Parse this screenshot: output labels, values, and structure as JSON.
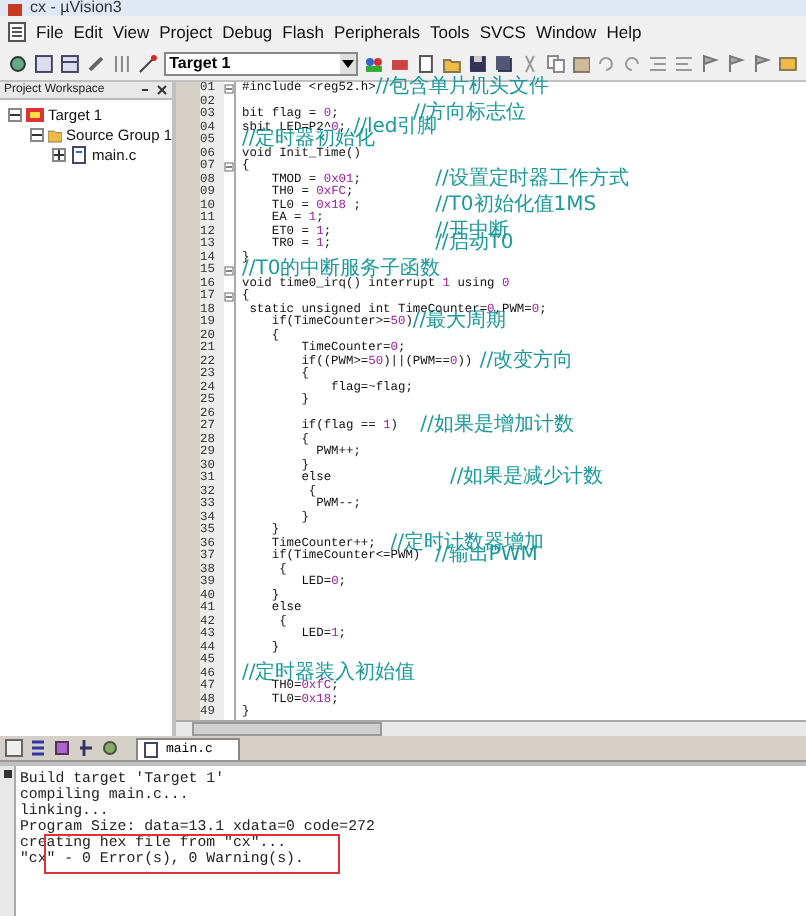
{
  "window": {
    "title": "cx - µVision3"
  },
  "menu": [
    "File",
    "Edit",
    "View",
    "Project",
    "Debug",
    "Flash",
    "Peripherals",
    "Tools",
    "SVCS",
    "Window",
    "Help"
  ],
  "toolbar": {
    "target": "Target 1"
  },
  "project_workspace": {
    "title": "Project Workspace",
    "tree": [
      {
        "label": "Target 1",
        "expanded": true,
        "children": [
          {
            "label": "Source Group 1",
            "expanded": true,
            "children": [
              {
                "label": "main.c",
                "expanded": false
              }
            ]
          }
        ]
      }
    ]
  },
  "editor": {
    "tab": "main.c",
    "lines": [
      {
        "n": "01",
        "code": "#include <reg52.h>",
        "comment": "//包含单片机头文件",
        "fold": true
      },
      {
        "n": "02",
        "fold": false
      },
      {
        "n": "03",
        "code": "bit flag = 0;          ",
        "comment": "//方向标志位",
        "fold": false
      },
      {
        "n": "04",
        "code": "sbit LED=P2^0; ",
        "comment": "//led引脚",
        "fold": false
      },
      {
        "n": "05",
        "comment": "//定时器初始化",
        "fold": false
      },
      {
        "n": "06",
        "code": "void Init_Time()",
        "fold": false
      },
      {
        "n": "07",
        "code": "{",
        "fold": true
      },
      {
        "n": "08",
        "code": "    TMOD = 0x01;          ",
        "comment": "//设置定时器工作方式",
        "fold": false
      },
      {
        "n": "09",
        "code": "    TH0 = 0xFC;",
        "fold": false
      },
      {
        "n": "10",
        "code": "    TL0 = 0x18 ;          ",
        "comment": "//T0初始化值1MS",
        "fold": false
      },
      {
        "n": "11",
        "code": "    EA = 1;",
        "fold": false
      },
      {
        "n": "12",
        "code": "    ET0 = 1;              ",
        "comment": "//开中断",
        "fold": false
      },
      {
        "n": "13",
        "code": "    TR0 = 1;              ",
        "comment": "//启动T0",
        "fold": false
      },
      {
        "n": "14",
        "code": "}",
        "fold": false
      },
      {
        "n": "15",
        "comment": "//T0的中断服务子函数",
        "fold": true
      },
      {
        "n": "16",
        "code": "void time0_irq() interrupt 1 using 0",
        "fold": false
      },
      {
        "n": "17",
        "code": "{",
        "fold": true
      },
      {
        "n": "18",
        "code": " static unsigned int TimeCounter=0,PWM=0;",
        "fold": false
      },
      {
        "n": "19",
        "code": "    if(TimeCounter>=50)",
        "comment": "//最大周期",
        "fold": false
      },
      {
        "n": "20",
        "code": "    {",
        "fold": false
      },
      {
        "n": "21",
        "code": "        TimeCounter=0;",
        "fold": false
      },
      {
        "n": "22",
        "code": "        if((PWM>=50)||(PWM==0)) ",
        "comment": "//改变方向",
        "fold": false
      },
      {
        "n": "23",
        "code": "        {",
        "fold": false
      },
      {
        "n": "24",
        "code": "            flag=~flag;",
        "fold": false
      },
      {
        "n": "25",
        "code": "        }",
        "fold": false
      },
      {
        "n": "26",
        "fold": false
      },
      {
        "n": "27",
        "code": "        if(flag == 1)   ",
        "comment": "//如果是增加计数",
        "fold": false
      },
      {
        "n": "28",
        "code": "        {",
        "fold": false
      },
      {
        "n": "29",
        "code": "          PWM++;",
        "fold": false
      },
      {
        "n": "30",
        "code": "        }",
        "fold": false
      },
      {
        "n": "31",
        "code": "        else                ",
        "comment": "//如果是减少计数",
        "fold": false
      },
      {
        "n": "32",
        "code": "         {",
        "fold": false
      },
      {
        "n": "33",
        "code": "          PWM--;",
        "fold": false
      },
      {
        "n": "34",
        "code": "        }",
        "fold": false
      },
      {
        "n": "35",
        "code": "    }",
        "fold": false
      },
      {
        "n": "36",
        "code": "    TimeCounter++;  ",
        "comment": "//定时计数器增加",
        "fold": false
      },
      {
        "n": "37",
        "code": "    if(TimeCounter<=PWM)  ",
        "comment": "//输出PWM",
        "fold": false
      },
      {
        "n": "38",
        "code": "     {",
        "fold": false
      },
      {
        "n": "39",
        "code": "        LED=0;",
        "fold": false
      },
      {
        "n": "40",
        "code": "    }",
        "fold": false
      },
      {
        "n": "41",
        "code": "    else",
        "fold": false
      },
      {
        "n": "42",
        "code": "     {",
        "fold": false
      },
      {
        "n": "43",
        "code": "        LED=1;",
        "fold": false
      },
      {
        "n": "44",
        "code": "    }",
        "fold": false
      },
      {
        "n": "45",
        "fold": false
      },
      {
        "n": "46",
        "comment": "//定时器装入初始值",
        "fold": false
      },
      {
        "n": "47",
        "code": "    TH0=0xfC;",
        "fold": false
      },
      {
        "n": "48",
        "code": "    TL0=0x18;",
        "fold": false
      },
      {
        "n": "49",
        "code": "}",
        "fold": false
      }
    ]
  },
  "output": {
    "lines": [
      "Build target 'Target 1'",
      "compiling main.c...",
      "linking...",
      "Program Size: data=13.1 xdata=0 code=272",
      "creating hex file from \"cx\"...",
      "\"cx\" - 0 Error(s), 0 Warning(s)."
    ]
  }
}
